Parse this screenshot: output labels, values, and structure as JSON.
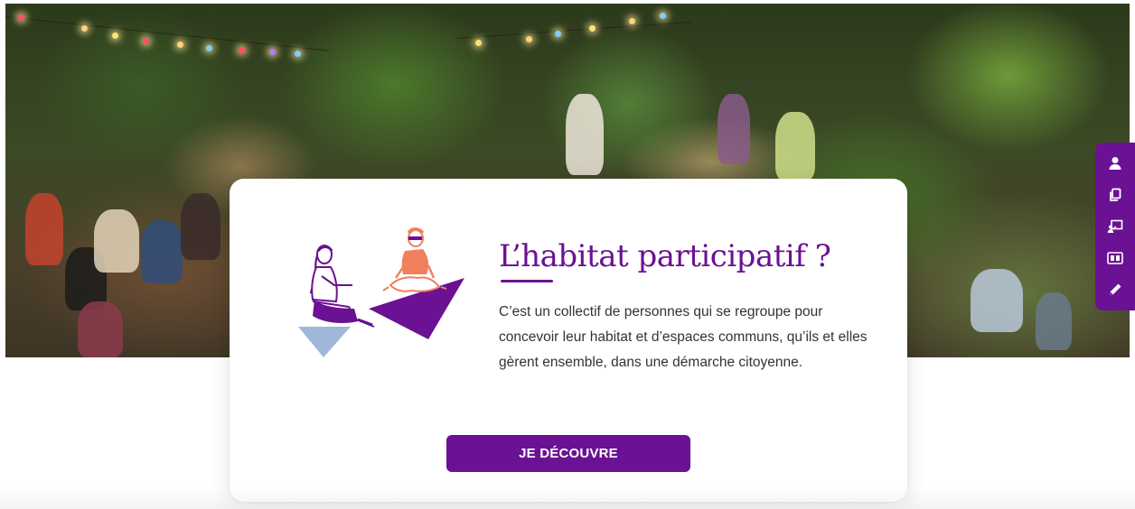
{
  "hero": {
    "image_description_icon": "photo-icon",
    "colors": {
      "lights": [
        "#ffd27a",
        "#ff4d6d",
        "#7ad0ff",
        "#b57aff",
        "#ffe36e"
      ]
    }
  },
  "card": {
    "title": "L’habitat participatif ?",
    "text": "C’est un collectif de personnes qui se regroupe pour concevoir leur habitat et d’espaces communs, qu’ils et elles gèrent ensemble, dans une démarche citoyenne.",
    "cta_label": "JE DÉCOUVRE"
  },
  "side_toolbar": {
    "items": [
      {
        "icon": "user-icon"
      },
      {
        "icon": "copy-icon"
      },
      {
        "icon": "presentation-icon"
      },
      {
        "icon": "id-card-icon"
      },
      {
        "icon": "pencil-icon"
      }
    ]
  },
  "colors": {
    "accent": "#6b1193",
    "illustration_shirt": "#f07f5e",
    "illustration_light": "#9fb8d9"
  }
}
